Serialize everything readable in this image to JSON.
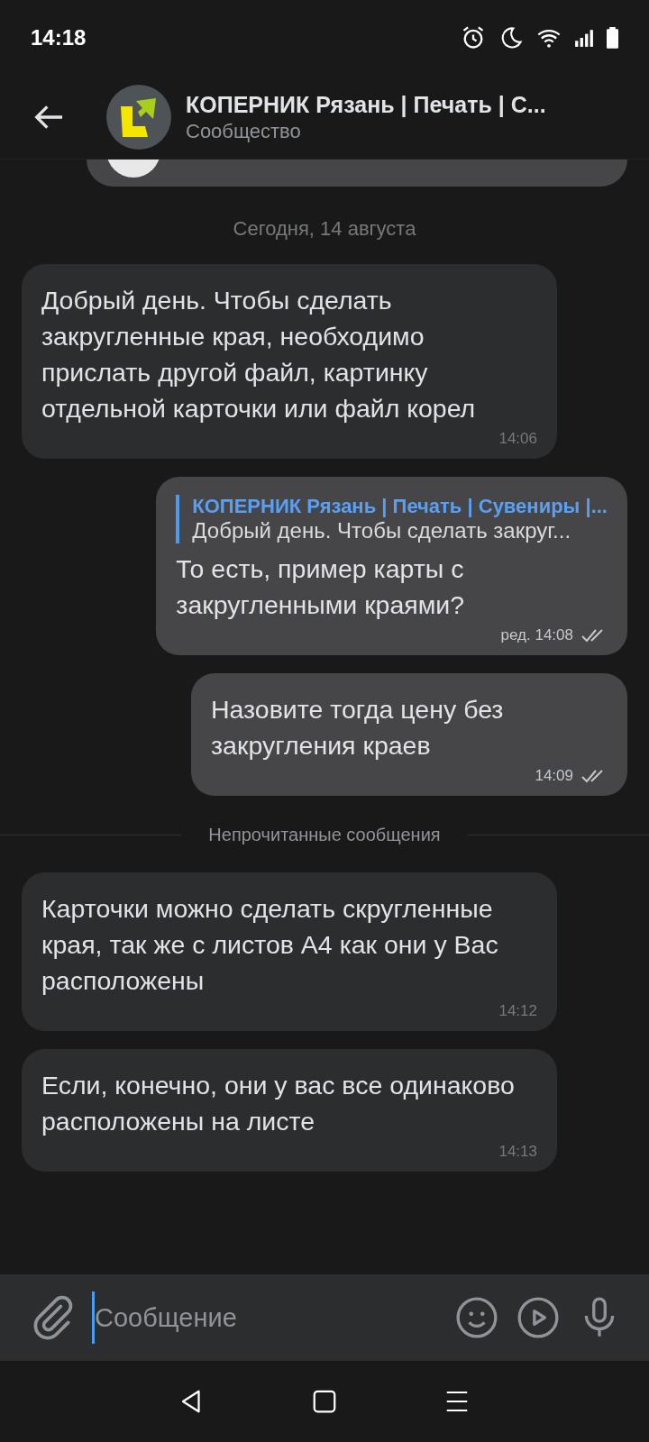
{
  "status_bar": {
    "time": "14:18"
  },
  "header": {
    "title": "КОПЕРНИК Рязань | Печать | С...",
    "subtitle": "Сообщество"
  },
  "messages": [
    {
      "kind": "date",
      "text": "Сегодня, 14 августа"
    },
    {
      "kind": "in",
      "text": "Добрый день. Чтобы сделать закругленные края, необходимо прислать другой файл, картинку отдельной карточки или файл корел",
      "time": "14:06"
    },
    {
      "kind": "out",
      "reply": {
        "author": "КОПЕРНИК Рязань | Печать | Сувениры |...",
        "text": "Добрый день. Чтобы сделать закруг..."
      },
      "text": "То есть, пример карты с закругленными краями?",
      "time": "ред. 14:08",
      "read": true
    },
    {
      "kind": "out",
      "text": "Назовите тогда цену без закругления краев",
      "time": "14:09",
      "read": true
    },
    {
      "kind": "divider",
      "text": "Непрочитанные сообщения"
    },
    {
      "kind": "in",
      "text": "Карточки можно сделать скругленные края, так же с листов А4 как они у Вас расположены",
      "time": "14:12"
    },
    {
      "kind": "in",
      "text": "Если, конечно, они у вас все одинаково расположены на листе",
      "time": "14:13"
    }
  ],
  "composer": {
    "placeholder": "Сообщение"
  }
}
